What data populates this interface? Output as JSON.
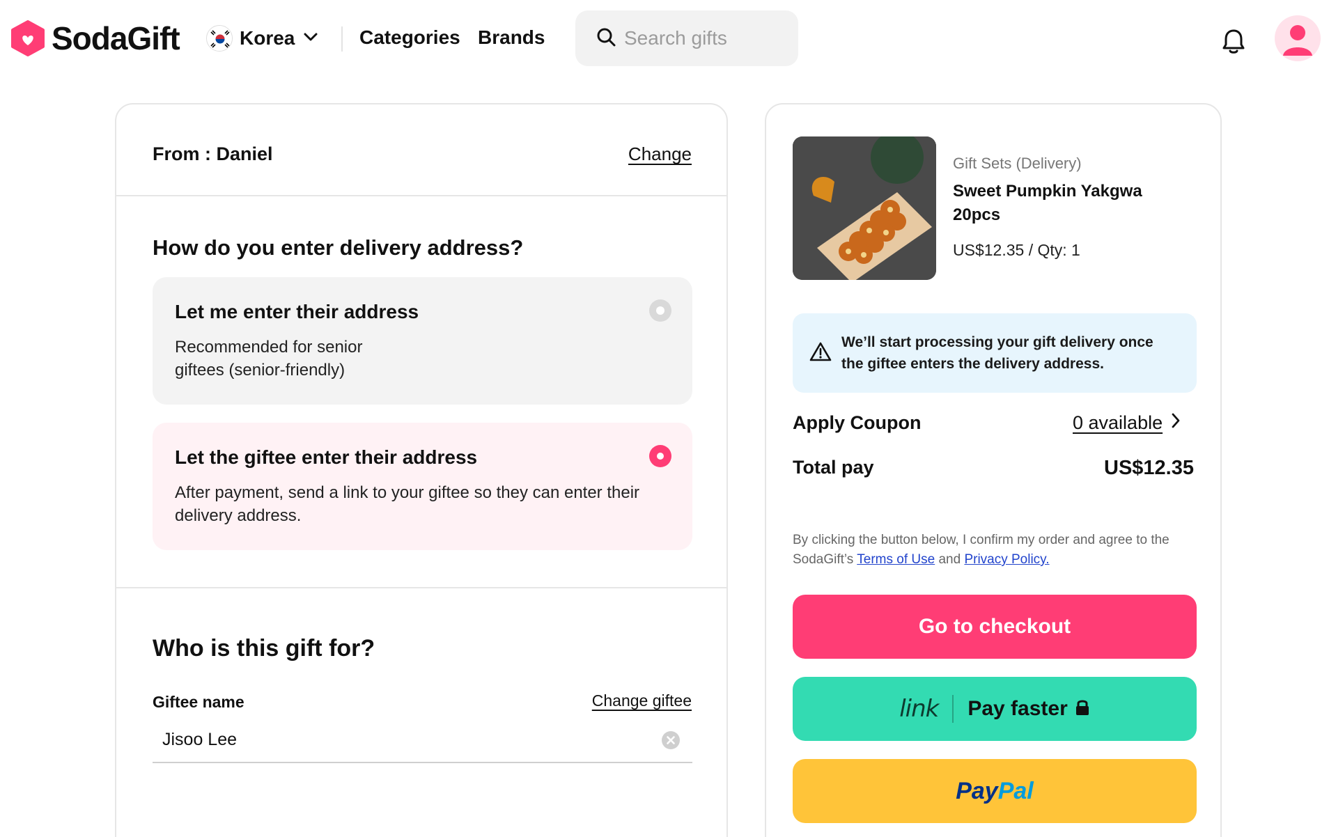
{
  "header": {
    "logo_text": "SodaGift",
    "country": "Korea",
    "nav": [
      "Categories",
      "Brands"
    ],
    "search_placeholder": "Search gifts"
  },
  "sender": {
    "from_text": "From : Daniel",
    "change_label": "Change"
  },
  "delivery": {
    "question": "How do you enter delivery address?",
    "options": [
      {
        "title": "Let me enter their address",
        "description": "Recommended for senior giftees (senior-friendly)",
        "selected": false
      },
      {
        "title": "Let the giftee enter their address",
        "description": "After payment, send a link to your giftee so they can enter their delivery address.",
        "selected": true
      }
    ]
  },
  "recipient": {
    "title": "Who is this gift for?",
    "name_label": "Giftee name",
    "change_label": "Change giftee",
    "name_value": "Jisoo Lee"
  },
  "product": {
    "category": "Gift Sets (Delivery)",
    "name": "Sweet Pumpkin Yakgwa 20pcs",
    "price_qty": "US$12.35 / Qty: 1"
  },
  "notice": {
    "text": "We’ll start processing your gift delivery once the giftee enters the delivery address."
  },
  "coupon": {
    "label": "Apply Coupon",
    "available": "0 available"
  },
  "total": {
    "label": "Total pay",
    "value": "US$12.35"
  },
  "legal": {
    "prefix": "By clicking the button below, I confirm my order and agree to the SodaGift’s ",
    "terms": "Terms of Use",
    "middle": " and ",
    "privacy": "Privacy Policy."
  },
  "buttons": {
    "checkout": "Go to checkout",
    "link_brand": "link",
    "link_label": "Pay faster",
    "paypal_1": "Pay",
    "paypal_2": "Pal"
  },
  "colors": {
    "brand_pink": "#ff3d75",
    "link_green": "#33dbb2",
    "paypal_yellow": "#ffc439",
    "notice_blue": "#e7f5fd"
  }
}
